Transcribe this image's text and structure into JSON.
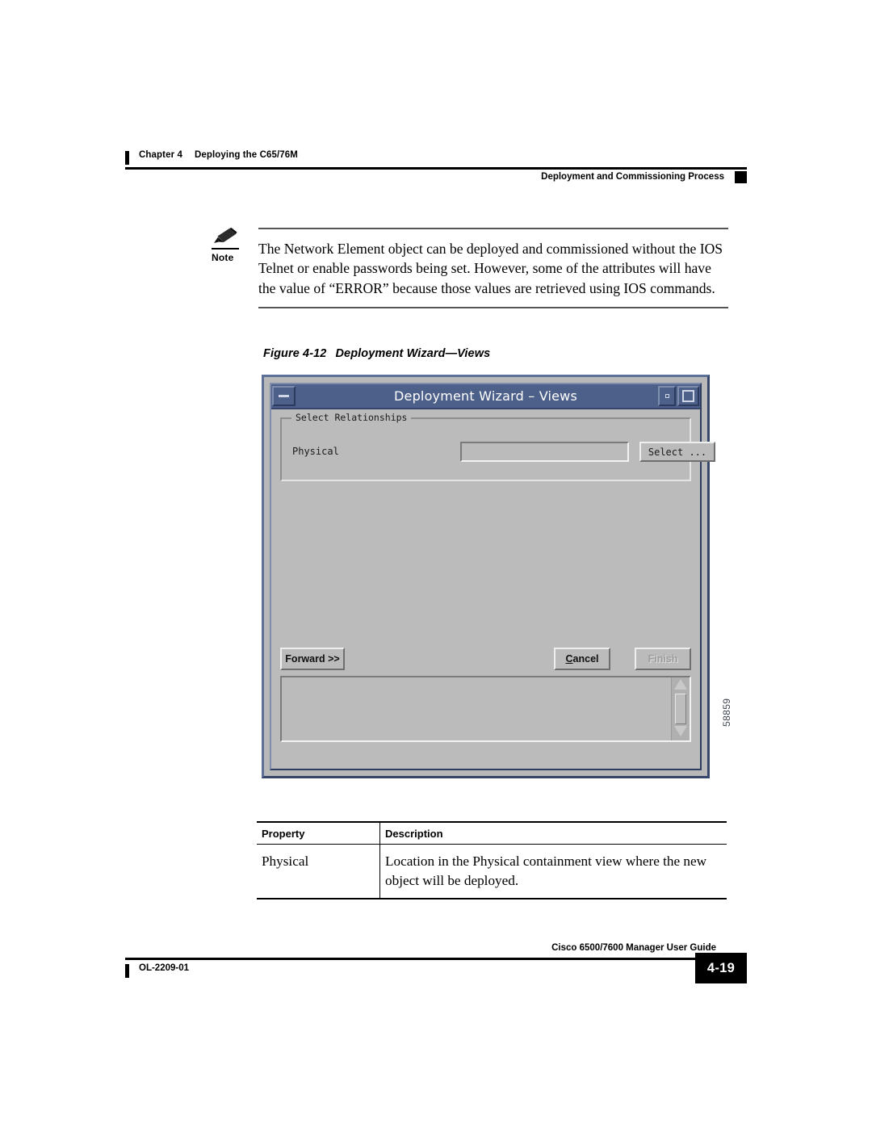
{
  "header": {
    "chapter_number": "Chapter 4",
    "chapter_title": "Deploying the C65/76M",
    "section_title": "Deployment and Commissioning Process"
  },
  "note": {
    "label": "Note",
    "text": "The Network Element object can be deployed and commissioned without the IOS Telnet or enable passwords being set. However, some of the attributes will have the value of “ERROR” because those values are retrieved using IOS commands."
  },
  "figure": {
    "number": "Figure 4-12",
    "title": "Deployment Wizard—Views",
    "id": "58859"
  },
  "dialog": {
    "title": "Deployment Wizard – Views",
    "titlebar": {
      "minimize_icon": "minimize-icon",
      "restore_icon": "restore-icon",
      "maximize_icon": "maximize-icon"
    },
    "group": {
      "legend": "Select Relationships",
      "field_label": "Physical",
      "field_value": "",
      "field_placeholder": "",
      "select_button": "Select ..."
    },
    "buttons": {
      "forward": "Forward >>",
      "cancel_prefix": "C",
      "cancel_rest": "ancel",
      "cancel_full": "Cancel",
      "finish": "Finish",
      "finish_enabled": "false"
    },
    "log": {
      "value": "",
      "scrollbar": {
        "up_icon": "scroll-up-arrow-icon",
        "down_icon": "scroll-down-arrow-icon"
      }
    },
    "colors": {
      "titlebar": "#4d608a",
      "body": "#bbbbbb",
      "frame": "#5d7098"
    }
  },
  "table": {
    "headers": [
      "Property",
      "Description"
    ],
    "rows": [
      [
        "Physical",
        "Location in the Physical containment view where the new object will be deployed."
      ]
    ]
  },
  "footer": {
    "guide_title": "Cisco 6500/7600 Manager User Guide",
    "doc_id": "OL-2209-01",
    "page_number": "4-19"
  }
}
